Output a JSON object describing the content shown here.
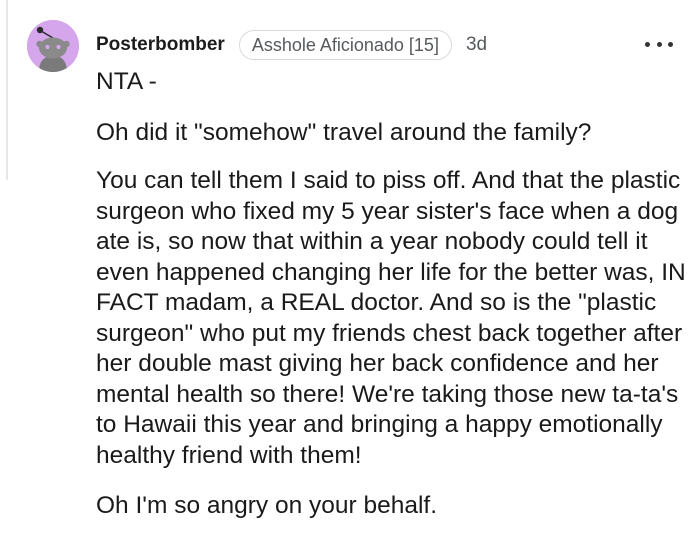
{
  "comment": {
    "username": "Posterbomber",
    "flair": "Asshole Aficionado [15]",
    "age": "3d",
    "paragraphs": [
      "NTA -",
      "Oh did it \"somehow\" travel around the family?",
      "You can tell them I said to piss off. And that the plastic surgeon who fixed my 5 year sister's face when a dog ate is, so now that within a year nobody could tell it even happened changing her life for the better was, IN FACT madam, a REAL doctor. And so is the \"plastic surgeon\" who put my friends chest back together after her double mast giving her back confidence and her mental health so there! We're taking those new ta-ta's to Hawaii this year and bringing a happy emotionally healthy friend with them!",
      "Oh I'm so angry on your behalf."
    ]
  },
  "colors": {
    "avatar_bg": "#d6a6ec",
    "text": "#1a1a1b",
    "meta": "#575a5c"
  },
  "icons": {
    "avatar": "snoo-avatar-icon",
    "more": "more-options-icon"
  }
}
